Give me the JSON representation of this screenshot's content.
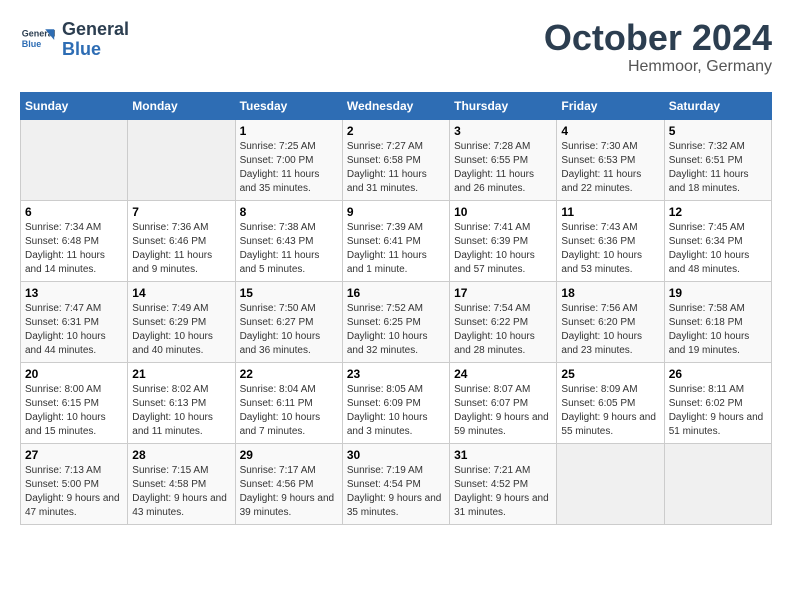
{
  "header": {
    "logo_line1": "General",
    "logo_line2": "Blue",
    "month": "October 2024",
    "location": "Hemmoor, Germany"
  },
  "weekdays": [
    "Sunday",
    "Monday",
    "Tuesday",
    "Wednesday",
    "Thursday",
    "Friday",
    "Saturday"
  ],
  "rows": [
    [
      {
        "day": "",
        "empty": true
      },
      {
        "day": "",
        "empty": true
      },
      {
        "day": "1",
        "sunrise": "7:25 AM",
        "sunset": "7:00 PM",
        "daylight": "11 hours and 35 minutes."
      },
      {
        "day": "2",
        "sunrise": "7:27 AM",
        "sunset": "6:58 PM",
        "daylight": "11 hours and 31 minutes."
      },
      {
        "day": "3",
        "sunrise": "7:28 AM",
        "sunset": "6:55 PM",
        "daylight": "11 hours and 26 minutes."
      },
      {
        "day": "4",
        "sunrise": "7:30 AM",
        "sunset": "6:53 PM",
        "daylight": "11 hours and 22 minutes."
      },
      {
        "day": "5",
        "sunrise": "7:32 AM",
        "sunset": "6:51 PM",
        "daylight": "11 hours and 18 minutes."
      }
    ],
    [
      {
        "day": "6",
        "sunrise": "7:34 AM",
        "sunset": "6:48 PM",
        "daylight": "11 hours and 14 minutes."
      },
      {
        "day": "7",
        "sunrise": "7:36 AM",
        "sunset": "6:46 PM",
        "daylight": "11 hours and 9 minutes."
      },
      {
        "day": "8",
        "sunrise": "7:38 AM",
        "sunset": "6:43 PM",
        "daylight": "11 hours and 5 minutes."
      },
      {
        "day": "9",
        "sunrise": "7:39 AM",
        "sunset": "6:41 PM",
        "daylight": "11 hours and 1 minute."
      },
      {
        "day": "10",
        "sunrise": "7:41 AM",
        "sunset": "6:39 PM",
        "daylight": "10 hours and 57 minutes."
      },
      {
        "day": "11",
        "sunrise": "7:43 AM",
        "sunset": "6:36 PM",
        "daylight": "10 hours and 53 minutes."
      },
      {
        "day": "12",
        "sunrise": "7:45 AM",
        "sunset": "6:34 PM",
        "daylight": "10 hours and 48 minutes."
      }
    ],
    [
      {
        "day": "13",
        "sunrise": "7:47 AM",
        "sunset": "6:31 PM",
        "daylight": "10 hours and 44 minutes."
      },
      {
        "day": "14",
        "sunrise": "7:49 AM",
        "sunset": "6:29 PM",
        "daylight": "10 hours and 40 minutes."
      },
      {
        "day": "15",
        "sunrise": "7:50 AM",
        "sunset": "6:27 PM",
        "daylight": "10 hours and 36 minutes."
      },
      {
        "day": "16",
        "sunrise": "7:52 AM",
        "sunset": "6:25 PM",
        "daylight": "10 hours and 32 minutes."
      },
      {
        "day": "17",
        "sunrise": "7:54 AM",
        "sunset": "6:22 PM",
        "daylight": "10 hours and 28 minutes."
      },
      {
        "day": "18",
        "sunrise": "7:56 AM",
        "sunset": "6:20 PM",
        "daylight": "10 hours and 23 minutes."
      },
      {
        "day": "19",
        "sunrise": "7:58 AM",
        "sunset": "6:18 PM",
        "daylight": "10 hours and 19 minutes."
      }
    ],
    [
      {
        "day": "20",
        "sunrise": "8:00 AM",
        "sunset": "6:15 PM",
        "daylight": "10 hours and 15 minutes."
      },
      {
        "day": "21",
        "sunrise": "8:02 AM",
        "sunset": "6:13 PM",
        "daylight": "10 hours and 11 minutes."
      },
      {
        "day": "22",
        "sunrise": "8:04 AM",
        "sunset": "6:11 PM",
        "daylight": "10 hours and 7 minutes."
      },
      {
        "day": "23",
        "sunrise": "8:05 AM",
        "sunset": "6:09 PM",
        "daylight": "10 hours and 3 minutes."
      },
      {
        "day": "24",
        "sunrise": "8:07 AM",
        "sunset": "6:07 PM",
        "daylight": "9 hours and 59 minutes."
      },
      {
        "day": "25",
        "sunrise": "8:09 AM",
        "sunset": "6:05 PM",
        "daylight": "9 hours and 55 minutes."
      },
      {
        "day": "26",
        "sunrise": "8:11 AM",
        "sunset": "6:02 PM",
        "daylight": "9 hours and 51 minutes."
      }
    ],
    [
      {
        "day": "27",
        "sunrise": "7:13 AM",
        "sunset": "5:00 PM",
        "daylight": "9 hours and 47 minutes."
      },
      {
        "day": "28",
        "sunrise": "7:15 AM",
        "sunset": "4:58 PM",
        "daylight": "9 hours and 43 minutes."
      },
      {
        "day": "29",
        "sunrise": "7:17 AM",
        "sunset": "4:56 PM",
        "daylight": "9 hours and 39 minutes."
      },
      {
        "day": "30",
        "sunrise": "7:19 AM",
        "sunset": "4:54 PM",
        "daylight": "9 hours and 35 minutes."
      },
      {
        "day": "31",
        "sunrise": "7:21 AM",
        "sunset": "4:52 PM",
        "daylight": "9 hours and 31 minutes."
      },
      {
        "day": "",
        "empty": true
      },
      {
        "day": "",
        "empty": true
      }
    ]
  ]
}
